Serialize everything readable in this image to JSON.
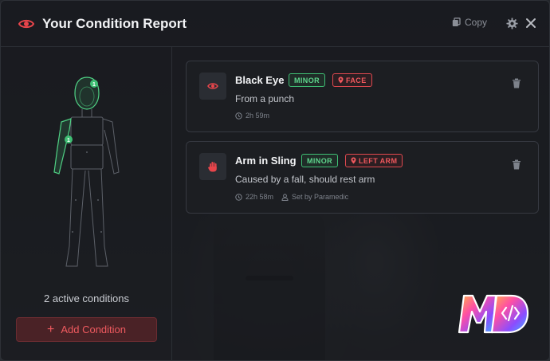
{
  "header": {
    "title": "Your Condition Report",
    "copy_label": "Copy"
  },
  "summary": {
    "active_text": "2 active conditions",
    "add_label": "Add Condition"
  },
  "body_markers": {
    "head": "1",
    "left_arm": "1"
  },
  "conditions": [
    {
      "title": "Black Eye",
      "icon": "eye-icon",
      "severity": "MINOR",
      "location": "FACE",
      "description": "From a punch",
      "time": "2h 59m"
    },
    {
      "title": "Arm in Sling",
      "icon": "hand-icon",
      "severity": "MINOR",
      "location": "LEFT ARM",
      "description": "Caused by a fall, should rest arm",
      "time": "22h 58m",
      "set_by": "Set by Paramedic"
    }
  ],
  "colors": {
    "accent_red": "#e8454b",
    "severity_green": "#4fd184",
    "panel_bg": "#1b1d21"
  },
  "logo_text": "MD"
}
